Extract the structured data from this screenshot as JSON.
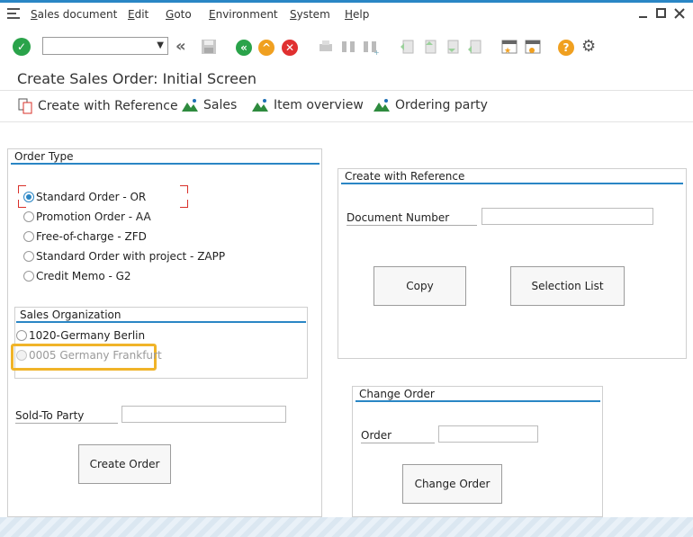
{
  "menu": {
    "items": [
      {
        "label": "Sales document",
        "underline": "S",
        "rest": "ales document"
      },
      {
        "label": "Edit",
        "underline": "E",
        "rest": "dit"
      },
      {
        "label": "Goto",
        "underline": "G",
        "rest": "oto"
      },
      {
        "label": "Environment",
        "underline": "E",
        "rest": "nvironment"
      },
      {
        "label": "System",
        "underline": "S",
        "rest": "ystem"
      },
      {
        "label": "Help",
        "underline": "H",
        "rest": "elp"
      }
    ]
  },
  "toolbar": {
    "command_field_value": "",
    "colors": {
      "enter_green": "#2aa34a",
      "back_green": "#2aa34a",
      "exit_orange": "#f0a020",
      "cancel_red": "#e03030",
      "help_orange": "#f0a020"
    }
  },
  "page": {
    "title": "Create Sales Order: Initial Screen"
  },
  "appbar": {
    "create_with_reference": "Create with Reference",
    "sales": "Sales",
    "item_overview": "Item overview",
    "ordering_party": "Ordering party"
  },
  "order_type": {
    "title": "Order Type",
    "options": [
      {
        "label": "Standard Order - OR",
        "selected": true
      },
      {
        "label": "Promotion Order - AA",
        "selected": false
      },
      {
        "label": "Free-of-charge - ZFD",
        "selected": false
      },
      {
        "label": "Standard Order with project - ZAPP",
        "selected": false
      },
      {
        "label": "Credit Memo - G2",
        "selected": false
      }
    ]
  },
  "sales_org": {
    "title": "Sales Organization",
    "options": [
      {
        "label": "1020-Germany Berlin",
        "enabled": true
      },
      {
        "label": "0005 Germany Frankfurt",
        "enabled": false
      }
    ]
  },
  "sold_to": {
    "label": "Sold-To Party",
    "value": ""
  },
  "create_order_button": "Create Order",
  "create_with_reference": {
    "title": "Create with Reference",
    "doc_number_label": "Document Number",
    "doc_number_value": "",
    "copy_button": "Copy",
    "selection_list_button": "Selection List"
  },
  "change_order": {
    "title": "Change Order",
    "order_label": "Order",
    "order_value": "",
    "button": "Change Order"
  }
}
